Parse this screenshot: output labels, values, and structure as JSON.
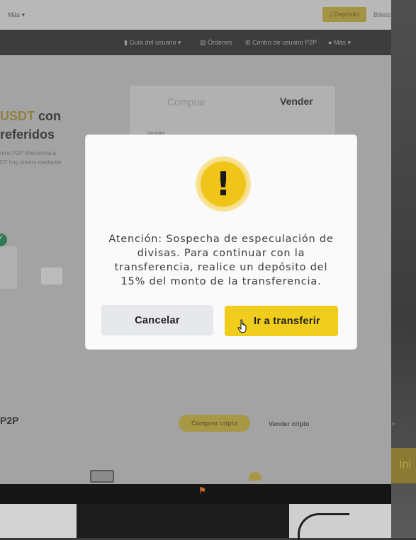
{
  "background_page": {
    "topbar": {
      "more_label": "Más ▾",
      "deposit_label": "⤓ Depósito",
      "wallet_label": "Billete"
    },
    "navbar": {
      "items": [
        {
          "label": "Guía del usuario ▾",
          "icon": "book-icon"
        },
        {
          "label": "Órdenes",
          "icon": "document-icon"
        },
        {
          "label": "Centro de usuario P2P",
          "icon": "user-center-icon"
        },
        {
          "label": "Más ▾",
          "icon": "globe-icon"
        }
      ]
    },
    "hero": {
      "line1_highlight": "USDT",
      "line1_rest": " con",
      "line2": "referidos",
      "sub_line1": "mos P2P. Encuentra a",
      "sub_line2": "DT hoy mismo mediante"
    },
    "trade_card": {
      "tab_buy": "Comprar",
      "tab_sell": "Vender",
      "field_label": "Vender"
    },
    "p2p_section": {
      "title": "P2P",
      "buy_crypto": "Comprar cripto",
      "sell_crypto": "Vender cripto"
    },
    "room_text": "Ini"
  },
  "modal": {
    "icon": "warning-icon",
    "icon_glyph": "!",
    "message": "Atención: Sospecha de especulación de divisas. Para continuar con la transferencia, realice un depósito del 15% del monto de la transferencia.",
    "cancel_label": "Cancelar",
    "confirm_label": "Ir a transferir"
  },
  "colors": {
    "accent_yellow": "#f0cd1d",
    "cancel_gray": "#e7e8ec",
    "overlay_dim": "#a3a3a3"
  }
}
